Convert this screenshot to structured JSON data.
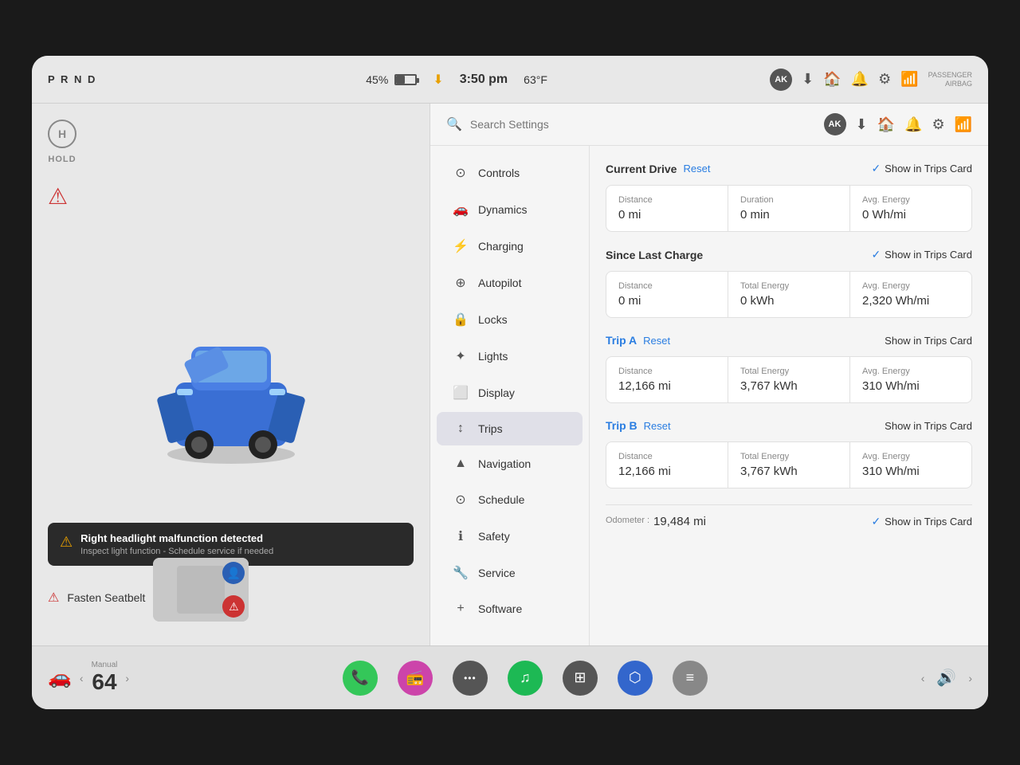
{
  "topBar": {
    "prnd": "P R N D",
    "battery_pct": "45%",
    "time": "3:50 pm",
    "temp": "63°F",
    "user_initials": "AK",
    "passenger_airbag_line1": "PASSENGER",
    "passenger_airbag_line2": "AIRBAG"
  },
  "alerts": {
    "headlight_title": "Right headlight malfunction detected",
    "headlight_sub": "Inspect light function - Schedule service if needed",
    "seatbelt_text": "Fasten Seatbelt"
  },
  "search": {
    "placeholder": "Search Settings"
  },
  "nav": {
    "items": [
      {
        "id": "controls",
        "icon": "⊙",
        "label": "Controls"
      },
      {
        "id": "dynamics",
        "icon": "🚗",
        "label": "Dynamics"
      },
      {
        "id": "charging",
        "icon": "⚡",
        "label": "Charging"
      },
      {
        "id": "autopilot",
        "icon": "⊕",
        "label": "Autopilot"
      },
      {
        "id": "locks",
        "icon": "🔒",
        "label": "Locks"
      },
      {
        "id": "lights",
        "icon": "✦",
        "label": "Lights"
      },
      {
        "id": "display",
        "icon": "⬜",
        "label": "Display"
      },
      {
        "id": "trips",
        "icon": "↕",
        "label": "Trips"
      },
      {
        "id": "navigation",
        "icon": "▲",
        "label": "Navigation"
      },
      {
        "id": "schedule",
        "icon": "⊙",
        "label": "Schedule"
      },
      {
        "id": "safety",
        "icon": "ℹ",
        "label": "Safety"
      },
      {
        "id": "service",
        "icon": "🔧",
        "label": "Service"
      },
      {
        "id": "software",
        "icon": "+",
        "label": "Software"
      }
    ]
  },
  "trips": {
    "current_drive": {
      "title": "Current Drive",
      "reset_label": "Reset",
      "show_trips_label": "Show in Trips Card",
      "show_trips_checked": true,
      "distance_label": "Distance",
      "distance_value": "0 mi",
      "duration_label": "Duration",
      "duration_value": "0 min",
      "avg_energy_label": "Avg. Energy",
      "avg_energy_value": "0 Wh/mi"
    },
    "since_last_charge": {
      "title": "Since Last Charge",
      "show_trips_label": "Show in Trips Card",
      "show_trips_checked": true,
      "distance_label": "Distance",
      "distance_value": "0 mi",
      "total_energy_label": "Total Energy",
      "total_energy_value": "0 kWh",
      "avg_energy_label": "Avg. Energy",
      "avg_energy_value": "2,320 Wh/mi"
    },
    "trip_a": {
      "title": "Trip A",
      "reset_label": "Reset",
      "show_trips_label": "Show in Trips Card",
      "show_trips_checked": false,
      "distance_label": "Distance",
      "distance_value": "12,166 mi",
      "total_energy_label": "Total Energy",
      "total_energy_value": "3,767 kWh",
      "avg_energy_label": "Avg. Energy",
      "avg_energy_value": "310 Wh/mi"
    },
    "trip_b": {
      "title": "Trip B",
      "reset_label": "Reset",
      "show_trips_label": "Show in Trips Card",
      "show_trips_checked": false,
      "distance_label": "Distance",
      "distance_value": "12,166 mi",
      "total_energy_label": "Total Energy",
      "total_energy_value": "3,767 kWh",
      "avg_energy_label": "Avg. Energy",
      "avg_energy_value": "310 Wh/mi"
    },
    "odometer_label": "Odometer :",
    "odometer_value": "19,484 mi",
    "odometer_show_trips_label": "Show in Trips Card",
    "odometer_show_trips_checked": true
  },
  "bottomBar": {
    "temp_label": "Manual",
    "temp_value": "64",
    "apps": [
      {
        "id": "phone",
        "icon": "📞",
        "color": "#34c759"
      },
      {
        "id": "radio",
        "icon": "📻",
        "color": "#cc44aa"
      },
      {
        "id": "dots",
        "icon": "•••",
        "color": "#666"
      },
      {
        "id": "spotify",
        "icon": "♫",
        "color": "#1db954"
      },
      {
        "id": "grid",
        "icon": "⊞",
        "color": "#666"
      },
      {
        "id": "bluetooth",
        "icon": "⬡",
        "color": "#3366cc"
      },
      {
        "id": "notes",
        "icon": "≡",
        "color": "#888"
      }
    ]
  }
}
